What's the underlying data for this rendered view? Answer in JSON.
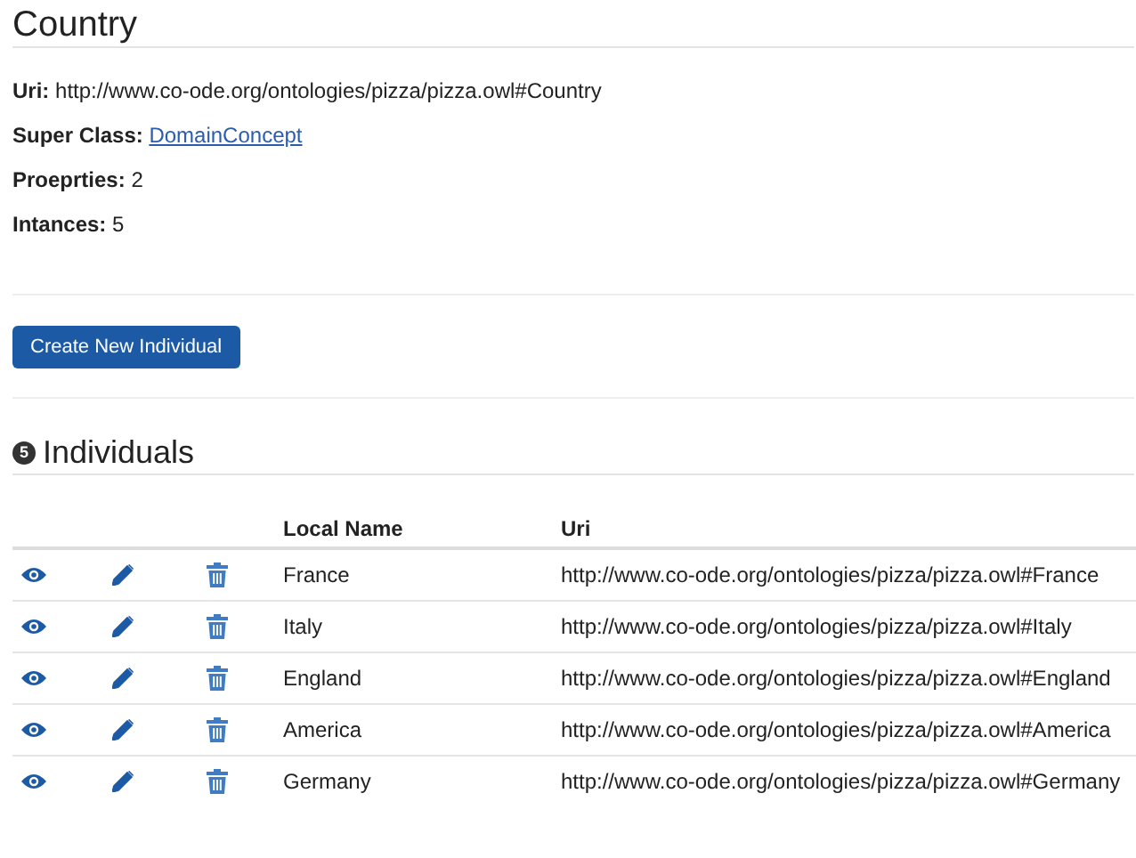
{
  "title": "Country",
  "properties": [
    {
      "label": "Uri:",
      "value": "http://www.co-ode.org/ontologies/pizza/pizza.owl#Country",
      "kind": "text"
    },
    {
      "label": "Super Class:",
      "value": "DomainConcept",
      "kind": "link"
    },
    {
      "label": "Proeprties:",
      "value": "2",
      "kind": "text"
    },
    {
      "label": "Intances:",
      "value": "5",
      "kind": "text"
    }
  ],
  "create_button": "Create New Individual",
  "individuals": {
    "count": "5",
    "title": "Individuals",
    "columns": [
      "Local Name",
      "Uri"
    ],
    "rows": [
      {
        "name": "France",
        "uri": "http://www.co-ode.org/ontologies/pizza/pizza.owl#France"
      },
      {
        "name": "Italy",
        "uri": "http://www.co-ode.org/ontologies/pizza/pizza.owl#Italy"
      },
      {
        "name": "England",
        "uri": "http://www.co-ode.org/ontologies/pizza/pizza.owl#England"
      },
      {
        "name": "America",
        "uri": "http://www.co-ode.org/ontologies/pizza/pizza.owl#America"
      },
      {
        "name": "Germany",
        "uri": "http://www.co-ode.org/ontologies/pizza/pizza.owl#Germany"
      }
    ]
  }
}
